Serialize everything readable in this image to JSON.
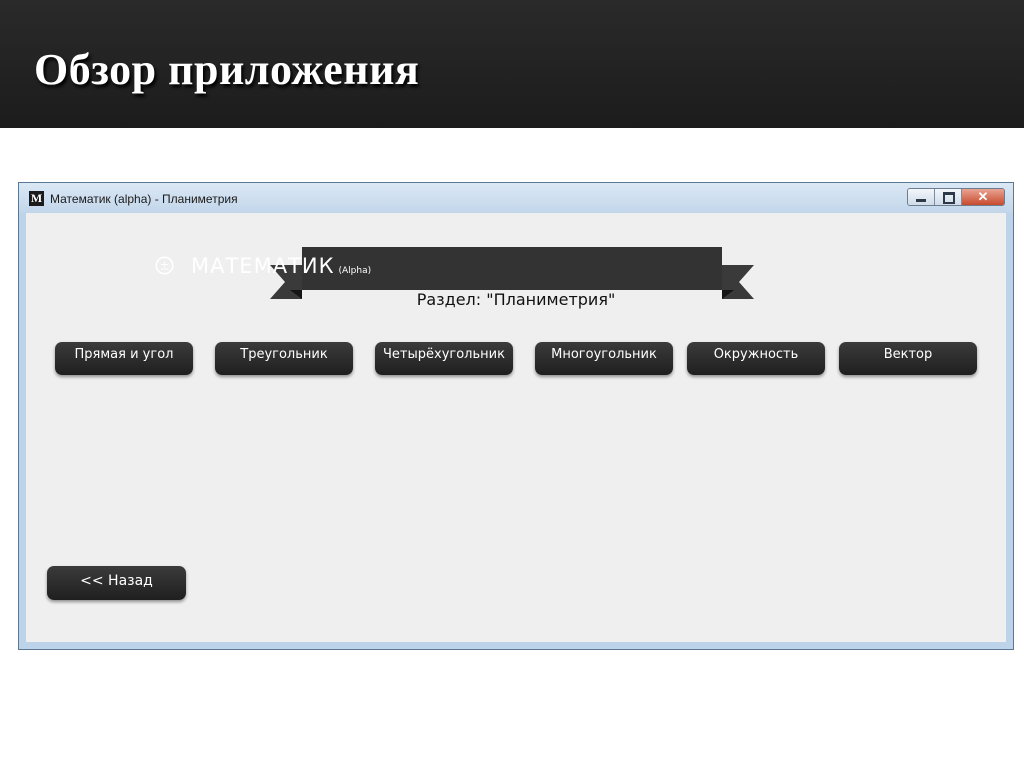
{
  "slide": {
    "title": "Обзор приложения"
  },
  "window": {
    "icon_letter": "M",
    "title": "Математик (alpha) - Планиметрия",
    "controls": {
      "close": "✕"
    }
  },
  "banner": {
    "symbol": "±",
    "app_name": "МАТЕМАТИК",
    "version_tag": "(Alpha)"
  },
  "section_label": "Раздел: \"Планиметрия\"",
  "topics": [
    "Прямая и угол",
    "Треугольник",
    "Четырёхугольник",
    "Многоугольник",
    "Окружность",
    "Вектор"
  ],
  "back_button": "<< Назад",
  "colors": {
    "header_bg": "#1f1f1f",
    "button_bg": "#2a2a2a",
    "client_bg": "#efefef"
  }
}
